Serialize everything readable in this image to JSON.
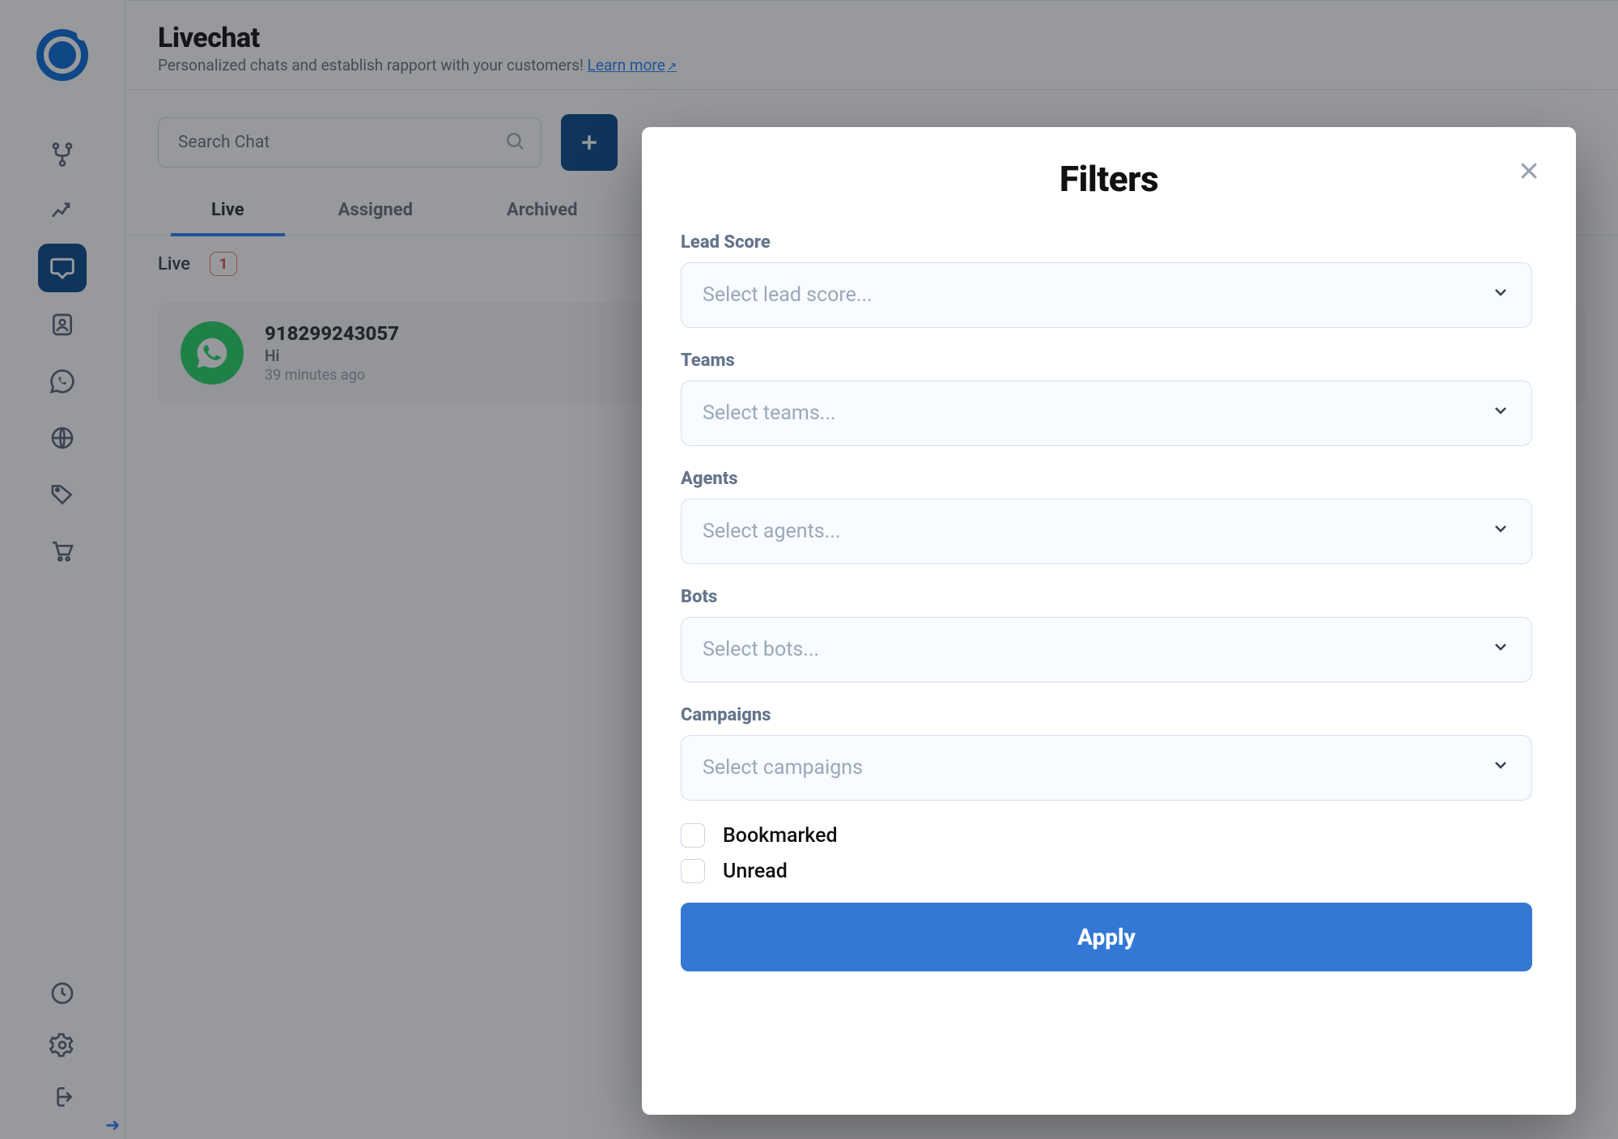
{
  "header": {
    "title": "Livechat",
    "subtitle": "Personalized chats and establish rapport with your customers!",
    "learn_more": "Learn more"
  },
  "search": {
    "placeholder": "Search Chat"
  },
  "tabs": {
    "t0": "Live",
    "t1": "Assigned",
    "t2": "Archived"
  },
  "sub": {
    "label": "Live",
    "count": "1"
  },
  "chat": {
    "name": "918299243057",
    "msg": "Hi",
    "time": "39 minutes ago",
    "tag": "SKIP"
  },
  "modal": {
    "title": "Filters",
    "lead_score_label": "Lead Score",
    "lead_score_placeholder": "Select lead score...",
    "teams_label": "Teams",
    "teams_placeholder": "Select teams...",
    "agents_label": "Agents",
    "agents_placeholder": "Select agents...",
    "bots_label": "Bots",
    "bots_placeholder": "Select bots...",
    "campaigns_label": "Campaigns",
    "campaigns_placeholder": "Select campaigns",
    "bookmarked_label": "Bookmarked",
    "unread_label": "Unread",
    "apply": "Apply"
  }
}
